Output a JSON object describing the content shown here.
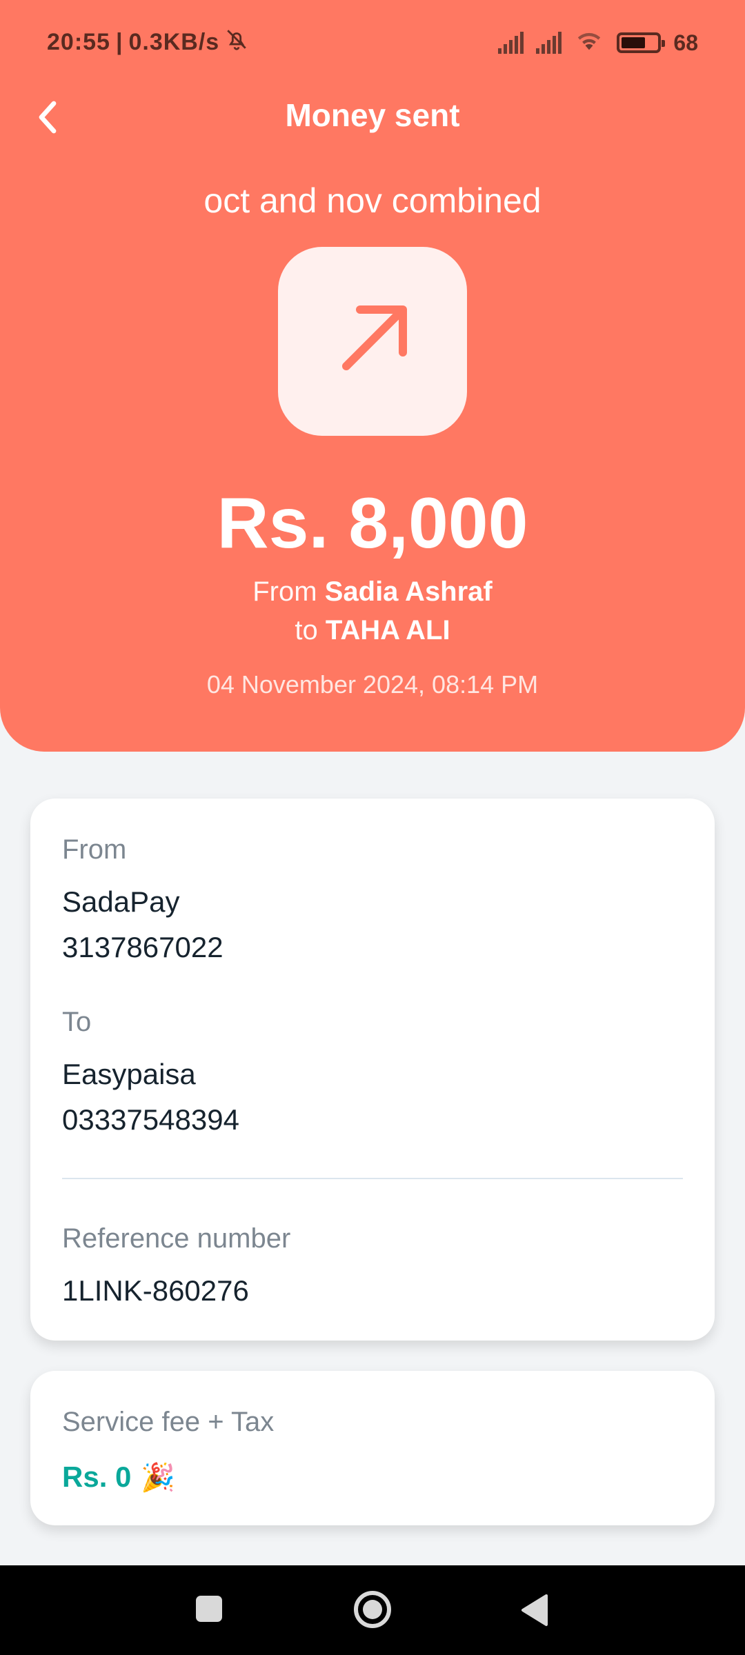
{
  "status_bar": {
    "time": "20:55",
    "net_speed": "0.3KB/s",
    "battery": "68"
  },
  "header": {
    "title": "Money sent",
    "caption": "oct and nov combined",
    "amount": "Rs. 8,000",
    "from_prefix": "From",
    "from_name": "Sadia Ashraf",
    "to_prefix": "to",
    "to_name": "TAHA ALI",
    "timestamp": "04 November 2024, 08:14 PM"
  },
  "details": {
    "from_label": "From",
    "from_bank": "SadaPay",
    "from_account": "3137867022",
    "to_label": "To",
    "to_bank": "Easypaisa",
    "to_account": "03337548394",
    "reference_label": "Reference number",
    "reference_value": "1LINK-860276"
  },
  "fee": {
    "label": "Service fee + Tax",
    "value": "Rs. 0",
    "emoji": "🎉"
  },
  "colors": {
    "header_bg": "#ff7862",
    "fee_value": "#0aa89a",
    "page_bg": "#f2f4f6"
  },
  "icons": {
    "back": "chevron-left-icon",
    "transaction": "arrow-up-right-icon",
    "nav_recents": "square-icon",
    "nav_home": "circle-icon",
    "nav_back": "triangle-back-icon"
  }
}
